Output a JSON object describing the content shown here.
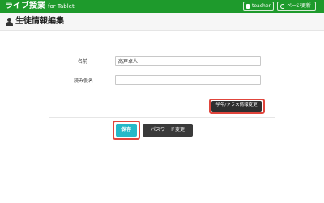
{
  "header": {
    "brand": "ライブ授業",
    "brand_sub": "for Tablet",
    "teacher_label": "teacher",
    "reload_label": "ページ更新",
    "icons": [
      "account-box-icon",
      "reload-icon"
    ],
    "color": "#1e9a2c"
  },
  "titlebar": {
    "title": "生徒情報編集",
    "icon": "user-icon"
  },
  "form": {
    "name_label": "名前",
    "name_value": "高戸卓人",
    "kana_label": "読み仮名",
    "kana_value": "",
    "class_button_label": "学年/クラス情報変更"
  },
  "actions": {
    "save_label": "保存",
    "password_label": "パスワード変更",
    "save_color": "#25b9c8",
    "highlight_color": "#e0453c"
  }
}
